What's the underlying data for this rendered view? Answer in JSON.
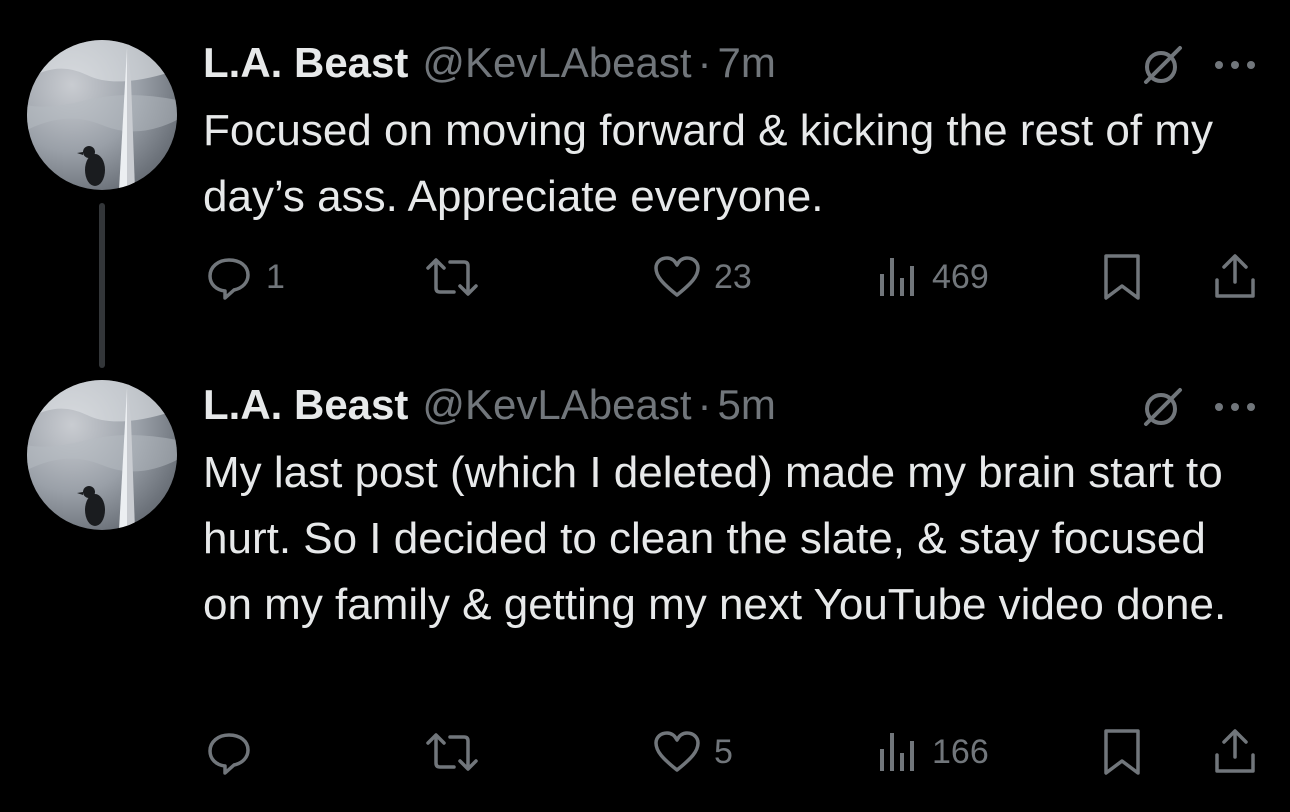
{
  "tweets": [
    {
      "name": "L.A. Beast",
      "handle": "@KevLAbeast",
      "separator": "·",
      "time": "7m",
      "text": "Focused on moving forward & kicking the rest of my day’s ass. Appreciate everyone.",
      "replies": "1",
      "likes": "23",
      "views": "469"
    },
    {
      "name": "L.A. Beast",
      "handle": "@KevLAbeast",
      "separator": "·",
      "time": "5m",
      "text": "My last post (which I deleted) made my brain start to hurt. So I decided to clean the slate, & stay focused on my family & getting my next YouTube video done.",
      "replies": "",
      "likes": "5",
      "views": "166"
    }
  ],
  "icons": {
    "reply": "reply-icon",
    "retweet": "retweet-icon",
    "like": "heart-icon",
    "views": "views-icon",
    "bookmark": "bookmark-icon",
    "share": "share-icon",
    "grok": "grok-icon",
    "more": "more-icon"
  },
  "colors": {
    "background": "#000000",
    "text": "#e7e9ea",
    "muted": "#71767b",
    "thread_line": "#333639"
  }
}
